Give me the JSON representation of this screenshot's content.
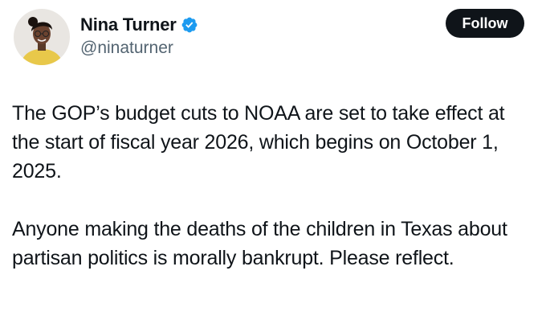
{
  "author": {
    "display_name": "Nina Turner",
    "handle": "@ninaturner",
    "verified": true,
    "avatar_icon": "profile-photo"
  },
  "actions": {
    "follow_label": "Follow"
  },
  "tweet": {
    "paragraphs": [
      "The GOP’s budget cuts to NOAA are set to take effect at the start of fiscal year 2026, which begins on October 1, 2025.",
      "Anyone making the deaths of the children in Texas about partisan politics is morally bankrupt. Please reflect."
    ]
  },
  "colors": {
    "text": "#0f1419",
    "secondary": "#536471",
    "verified": "#1d9bf0",
    "button_bg": "#0f1419",
    "button_text": "#ffffff"
  }
}
